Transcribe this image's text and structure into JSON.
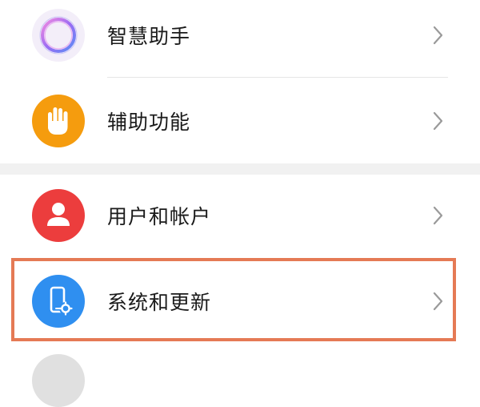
{
  "settings": {
    "items": [
      {
        "label": "智慧助手",
        "icon": "ai-assistant-icon"
      },
      {
        "label": "辅助功能",
        "icon": "hand-icon"
      },
      {
        "label": "用户和帐户",
        "icon": "user-icon"
      },
      {
        "label": "系统和更新",
        "icon": "system-update-icon"
      }
    ]
  },
  "colors": {
    "accessibility": "#f59c0e",
    "users": "#ec3d3d",
    "system": "#2f8ff0",
    "highlight": "#e57a55"
  }
}
